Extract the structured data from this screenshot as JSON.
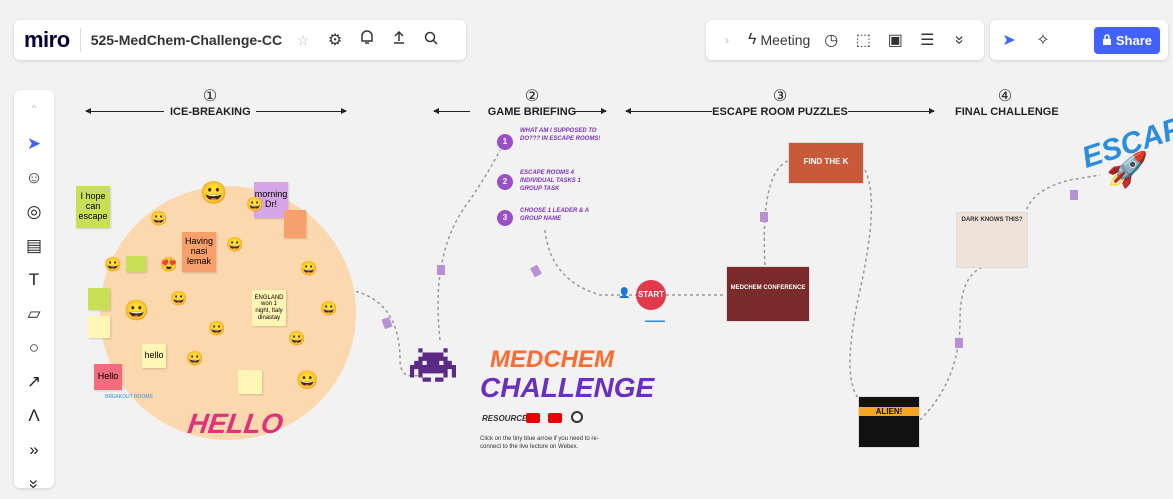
{
  "header": {
    "logo": "miro",
    "board_name": "525-MedChem-Challenge-CC",
    "meeting_label": "Meeting",
    "share_label": "Share"
  },
  "icons": {
    "star": "☆",
    "settings": "⚙",
    "bell": "🔔",
    "export": "⇪",
    "search": "⌕",
    "meeting": "ϟ",
    "timer": "◷",
    "card": "⬚",
    "present": "▣",
    "notes": "☰",
    "more": "»",
    "cursor": "➤",
    "reactions": "✧",
    "lock": "🔒"
  },
  "tools": [
    "⌃",
    "➤",
    "☺",
    "◎",
    "▤",
    "T",
    "▱",
    "○",
    "↗",
    "Λ",
    "»",
    "»"
  ],
  "sections": [
    {
      "num": "①",
      "title": "ICE-BREAKING"
    },
    {
      "num": "②",
      "title": "GAME BRIEFING"
    },
    {
      "num": "③",
      "title": "ESCAPE ROOM PUZZLES"
    },
    {
      "num": "④",
      "title": "FINAL CHALLENGE"
    }
  ],
  "icebreaking": {
    "notes": [
      "I hope can escape",
      "morning Dr!",
      "Having nasi lemak",
      "ENGLAND won 1 night, Italy dinastay",
      "hello",
      "Hello"
    ],
    "big_hello": "HELLO",
    "breakout": "BREAKOUT ROOMS"
  },
  "briefing": {
    "steps": [
      {
        "n": "1",
        "text": "WHAT AM I SUPPOSED TO DO??? IN ESCAPE ROOMS!"
      },
      {
        "n": "2",
        "text": "ESCAPE ROOMS 4 INDIVIDUAL TASKS 1 GROUP TASK"
      },
      {
        "n": "3",
        "text": "CHOOSE 1 LEADER & A GROUP NAME"
      }
    ]
  },
  "challenge": {
    "title1": "MEDCHEM",
    "title2": "CHALLENGE",
    "resources": "RESOURCES",
    "instruction": "Click on the tiny blue arrow if you need to re-connect to the live lecture on Webex."
  },
  "puzzles": {
    "start": "START",
    "card1": "FIND THE K",
    "card2": "MEDCHEM CONFERENCE",
    "card3": "ALIEN!",
    "card4": "DARK KNOWS THIS?",
    "escape": "ESCAPE!"
  }
}
